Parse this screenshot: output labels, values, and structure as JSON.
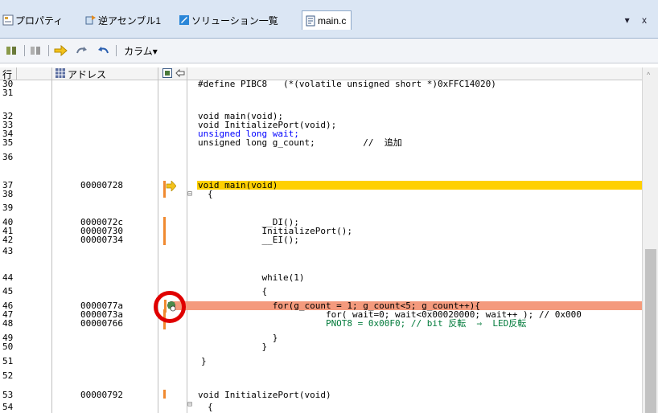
{
  "tabs": [
    {
      "label": "プロパティ",
      "icon": "properties-icon",
      "active": false
    },
    {
      "label": "逆アセンブル1",
      "icon": "disassembly-icon",
      "active": false
    },
    {
      "label": "ソリューション一覧",
      "icon": "solution-list-icon",
      "active": false
    },
    {
      "label": "main.c",
      "icon": "source-file-icon",
      "active": true
    }
  ],
  "tab_controls": "▾ x",
  "toolbar": {
    "column_label": "カラム▾",
    "buttons": [
      "step-in-icon",
      "step-over-icon",
      "go-to-current-icon",
      "redo-icon",
      "undo-icon"
    ]
  },
  "column_headers": {
    "line": "行",
    "address": "アドレス"
  },
  "rows": [
    {
      "line": "30",
      "addr": "",
      "code": "#define PIBC8   (*(volatile unsigned short *)0xFFC14020)"
    },
    {
      "line": "31",
      "addr": "",
      "code": ""
    },
    {
      "line": "32",
      "addr": "",
      "code": "void main(void);"
    },
    {
      "line": "33",
      "addr": "",
      "code": "void InitializePort(void);"
    },
    {
      "line": "34",
      "addr": "",
      "code": "unsigned long wait;"
    },
    {
      "line": "35",
      "addr": "",
      "code": "unsigned long g_count;         //  追加"
    },
    {
      "line": "36",
      "addr": "",
      "code": ""
    },
    {
      "line": "37",
      "addr": "00000728",
      "code": "void main(void)"
    },
    {
      "line": "38",
      "addr": "",
      "code": "{"
    },
    {
      "line": "39",
      "addr": "",
      "code": ""
    },
    {
      "line": "40",
      "addr": "0000072c",
      "code": "            __DI();"
    },
    {
      "line": "41",
      "addr": "00000730",
      "code": "            InitializePort();"
    },
    {
      "line": "42",
      "addr": "00000734",
      "code": "            __EI();"
    },
    {
      "line": "43",
      "addr": "",
      "code": ""
    },
    {
      "line": "44",
      "addr": "",
      "code": "            while(1)"
    },
    {
      "line": "45",
      "addr": "",
      "code": "            {"
    },
    {
      "line": "46",
      "addr": "0000077a",
      "code": "              for(g_count = 1; g_count<5; g_count++){"
    },
    {
      "line": "47",
      "addr": "0000073a",
      "code": "                        for( wait=0; wait<0x00020000; wait++ ); // 0x000"
    },
    {
      "line": "48",
      "addr": "00000766",
      "code": "                        PNOT8 = 0x00F0; // bit 反転  ⇒  LED反転"
    },
    {
      "line": "49",
      "addr": "",
      "code": "              }"
    },
    {
      "line": "50",
      "addr": "",
      "code": "            }"
    },
    {
      "line": "51",
      "addr": "",
      "code": "}"
    },
    {
      "line": "52",
      "addr": "",
      "code": ""
    },
    {
      "line": "53",
      "addr": "00000792",
      "code": "void InitializePort(void)"
    },
    {
      "line": "54",
      "addr": "",
      "code": "{"
    }
  ],
  "colors": {
    "current_line": "#ffd000",
    "breakpoint_line": "#f49a7d",
    "marker": "#f08a30",
    "circle": "#e00000"
  }
}
